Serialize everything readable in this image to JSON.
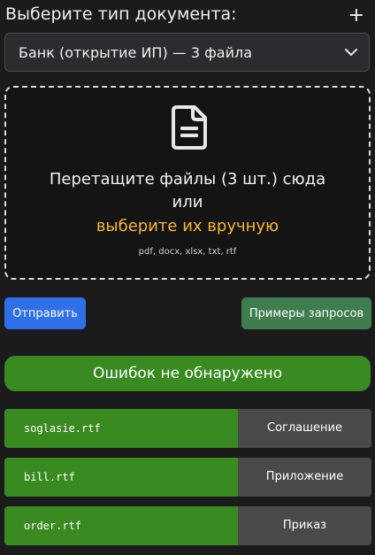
{
  "header": {
    "title": "Выберите тип документа:",
    "add_label": "+"
  },
  "doc_type_select": {
    "selected": "Банк (открытие ИП) — 3 файла",
    "icon": "chevron-down-icon"
  },
  "dropzone": {
    "icon": "file-text-icon",
    "line1": "Перетащите файлы (3 шт.) сюда",
    "line2": "или",
    "link_text": "выберите их вручную",
    "formats": "pdf, docx, xlsx, txt, rtf"
  },
  "buttons": {
    "send": "Отправить",
    "examples": "Примеры запросов"
  },
  "status": {
    "text": "Ошибок не обнаружено"
  },
  "files": [
    {
      "name": "soglasie.rtf",
      "type": "Соглашение"
    },
    {
      "name": "bill.rtf",
      "type": "Приложение"
    },
    {
      "name": "order.rtf",
      "type": "Приказ"
    }
  ],
  "colors": {
    "background": "#1b1b1c",
    "primary_button": "#2f6fe8",
    "secondary_button": "#3f7d4f",
    "success": "#3a8a22",
    "link": "#f7b731",
    "type_cell": "#4a4a4a"
  }
}
